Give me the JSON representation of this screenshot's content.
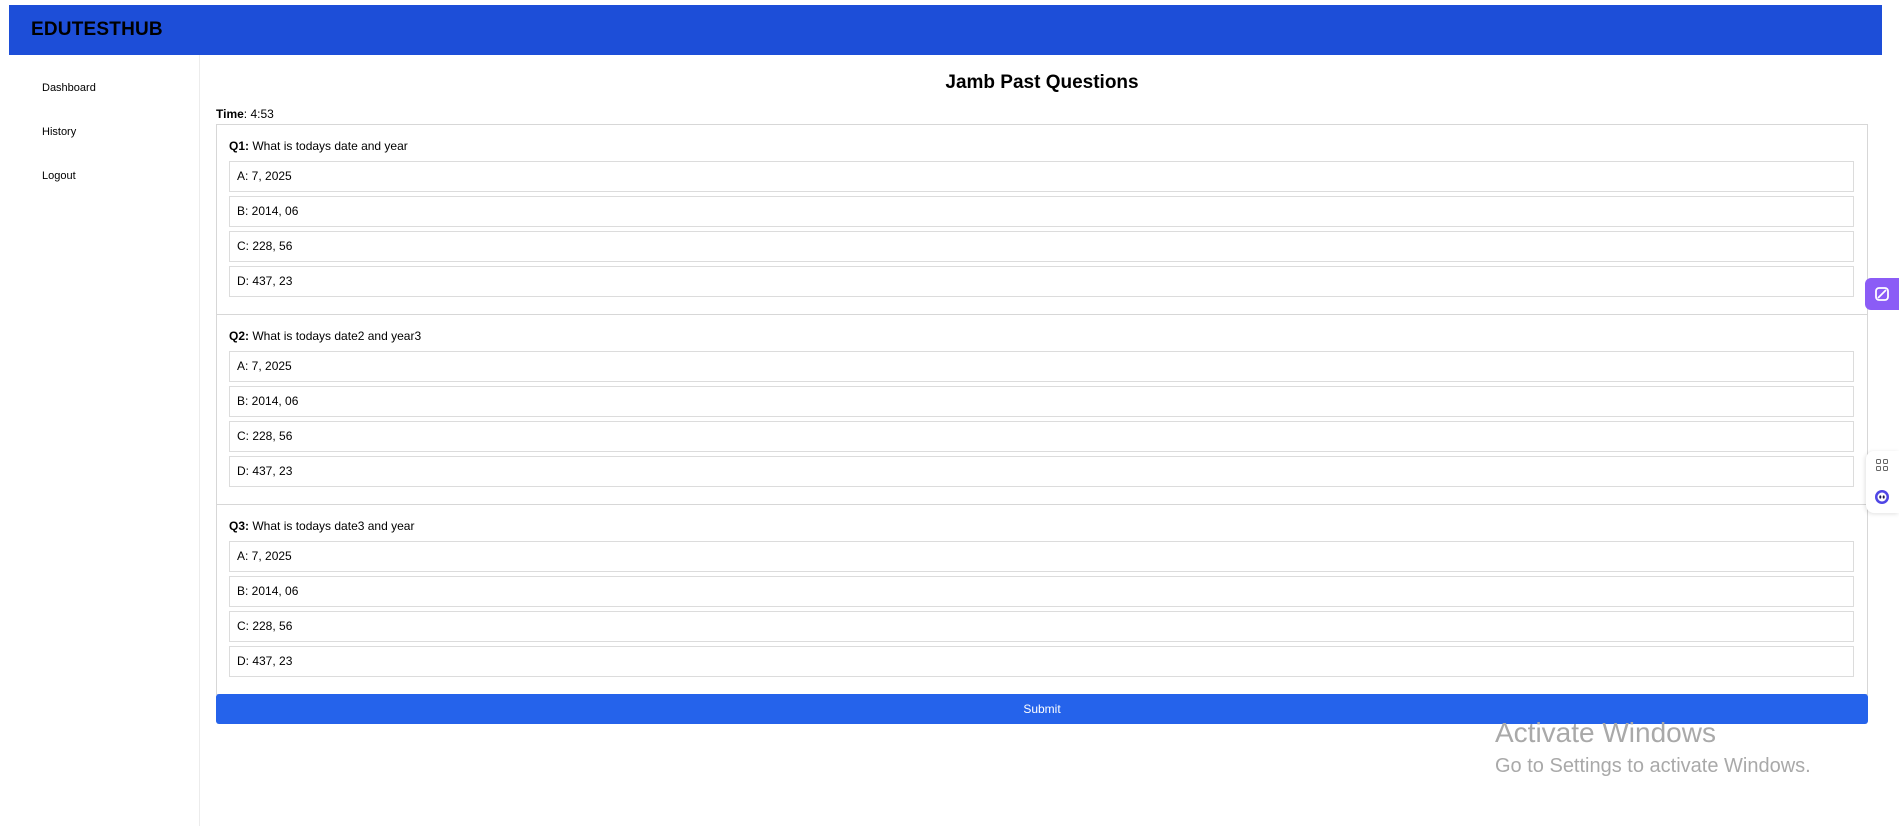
{
  "header": {
    "brand": "EDUTESTHUB",
    "color": "#1d4ed8"
  },
  "sidebar": {
    "items": [
      {
        "label": "Dashboard"
      },
      {
        "label": "History"
      },
      {
        "label": "Logout"
      }
    ]
  },
  "main": {
    "title": "Jamb Past Questions",
    "timer": {
      "label": "Time",
      "value": ": 4:53"
    },
    "questions": [
      {
        "number": "Q1:",
        "text": " What is todays date and year",
        "options": [
          "A: 7, 2025",
          "B: 2014, 06",
          "C: 228, 56",
          "D: 437, 23"
        ]
      },
      {
        "number": "Q2:",
        "text": " What is todays date2 and year3",
        "options": [
          "A: 7, 2025",
          "B: 2014, 06",
          "C: 228, 56",
          "D: 437, 23"
        ]
      },
      {
        "number": "Q3:",
        "text": " What is todays date3 and year",
        "options": [
          "A: 7, 2025",
          "B: 2014, 06",
          "C: 228, 56",
          "D: 437, 23"
        ]
      }
    ],
    "submit_label": "Submit",
    "submit_color": "#2563eb"
  },
  "watermark": {
    "title": "Activate Windows",
    "subtitle": "Go to Settings to activate Windows."
  },
  "extensions": {
    "badge_icon": "blocked-icon",
    "badge_color": "#8b5cf6",
    "tools": [
      "apps-grid-icon",
      "assistant-bot-icon"
    ]
  }
}
